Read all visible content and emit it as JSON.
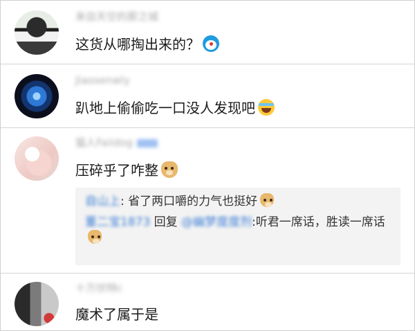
{
  "comments": [
    {
      "username": "来自天空的那之城",
      "text": "这货从哪掏出来的？",
      "emoji": "doraemon-emoji"
    },
    {
      "username": "Jiaosenwly",
      "text": "趴地上偷偷吃一口没人发现吧",
      "emoji": "laughing-crying-emoji"
    },
    {
      "username": "猫人Faiidog",
      "text": "压碎乎了咋整",
      "emoji": "doge-emoji",
      "replies": [
        {
          "author": "自山上",
          "text": "省了两口嚼的力气也挺好"
        },
        {
          "author": "董二宝1873",
          "reply_word": "回复",
          "target": "@幽梦度度剂",
          "text": ":听君一席话，胜读一席话"
        }
      ]
    },
    {
      "username": "十万伏特c",
      "text": "魔术了属于是"
    }
  ]
}
